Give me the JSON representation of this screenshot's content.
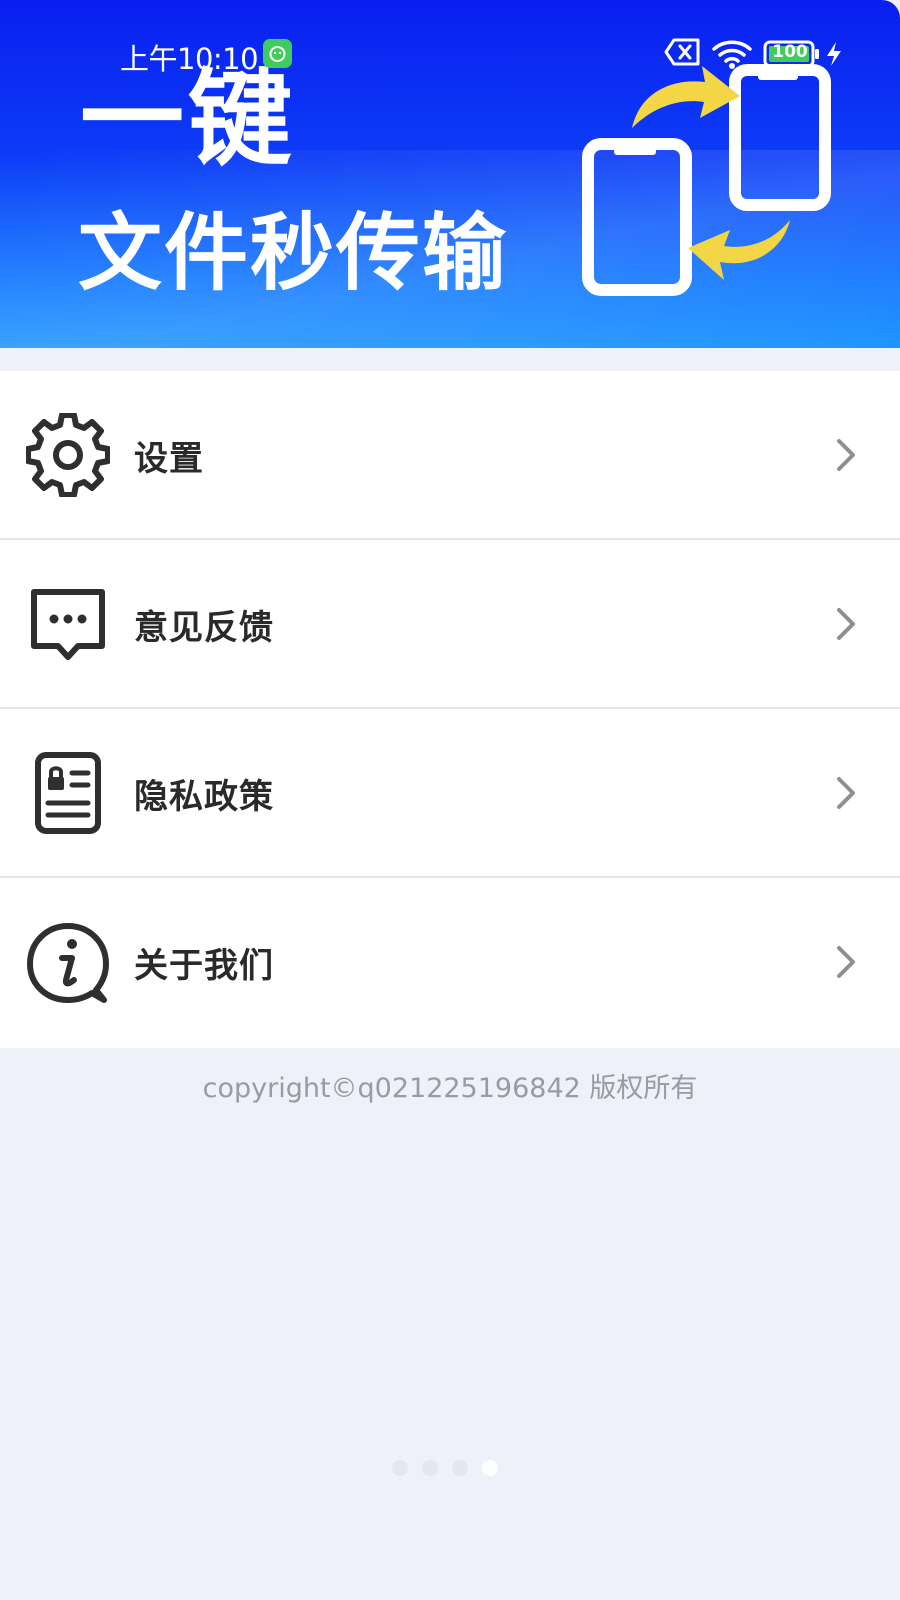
{
  "status_bar": {
    "time": "上午10:10",
    "battery": "100",
    "icons": [
      "app-notification-icon",
      "sim-none-icon",
      "wifi-icon",
      "battery-icon",
      "charging-icon"
    ]
  },
  "banner": {
    "line1": "一键",
    "line2": "文件秒传输",
    "illustration": "phone-transfer-icon",
    "colors": {
      "gradient_top": "#0a1ff0",
      "gradient_bottom": "#2196ff",
      "arrow": "#f3d646"
    }
  },
  "menu": {
    "items": [
      {
        "label": "设置",
        "icon": "gear-icon"
      },
      {
        "label": "意见反馈",
        "icon": "feedback-icon"
      },
      {
        "label": "隐私政策",
        "icon": "privacy-icon"
      },
      {
        "label": "关于我们",
        "icon": "info-icon"
      }
    ]
  },
  "footer": {
    "copyright": "copyright©q021225196842 版权所有"
  },
  "pager": {
    "count": 4,
    "active_index": 3
  }
}
